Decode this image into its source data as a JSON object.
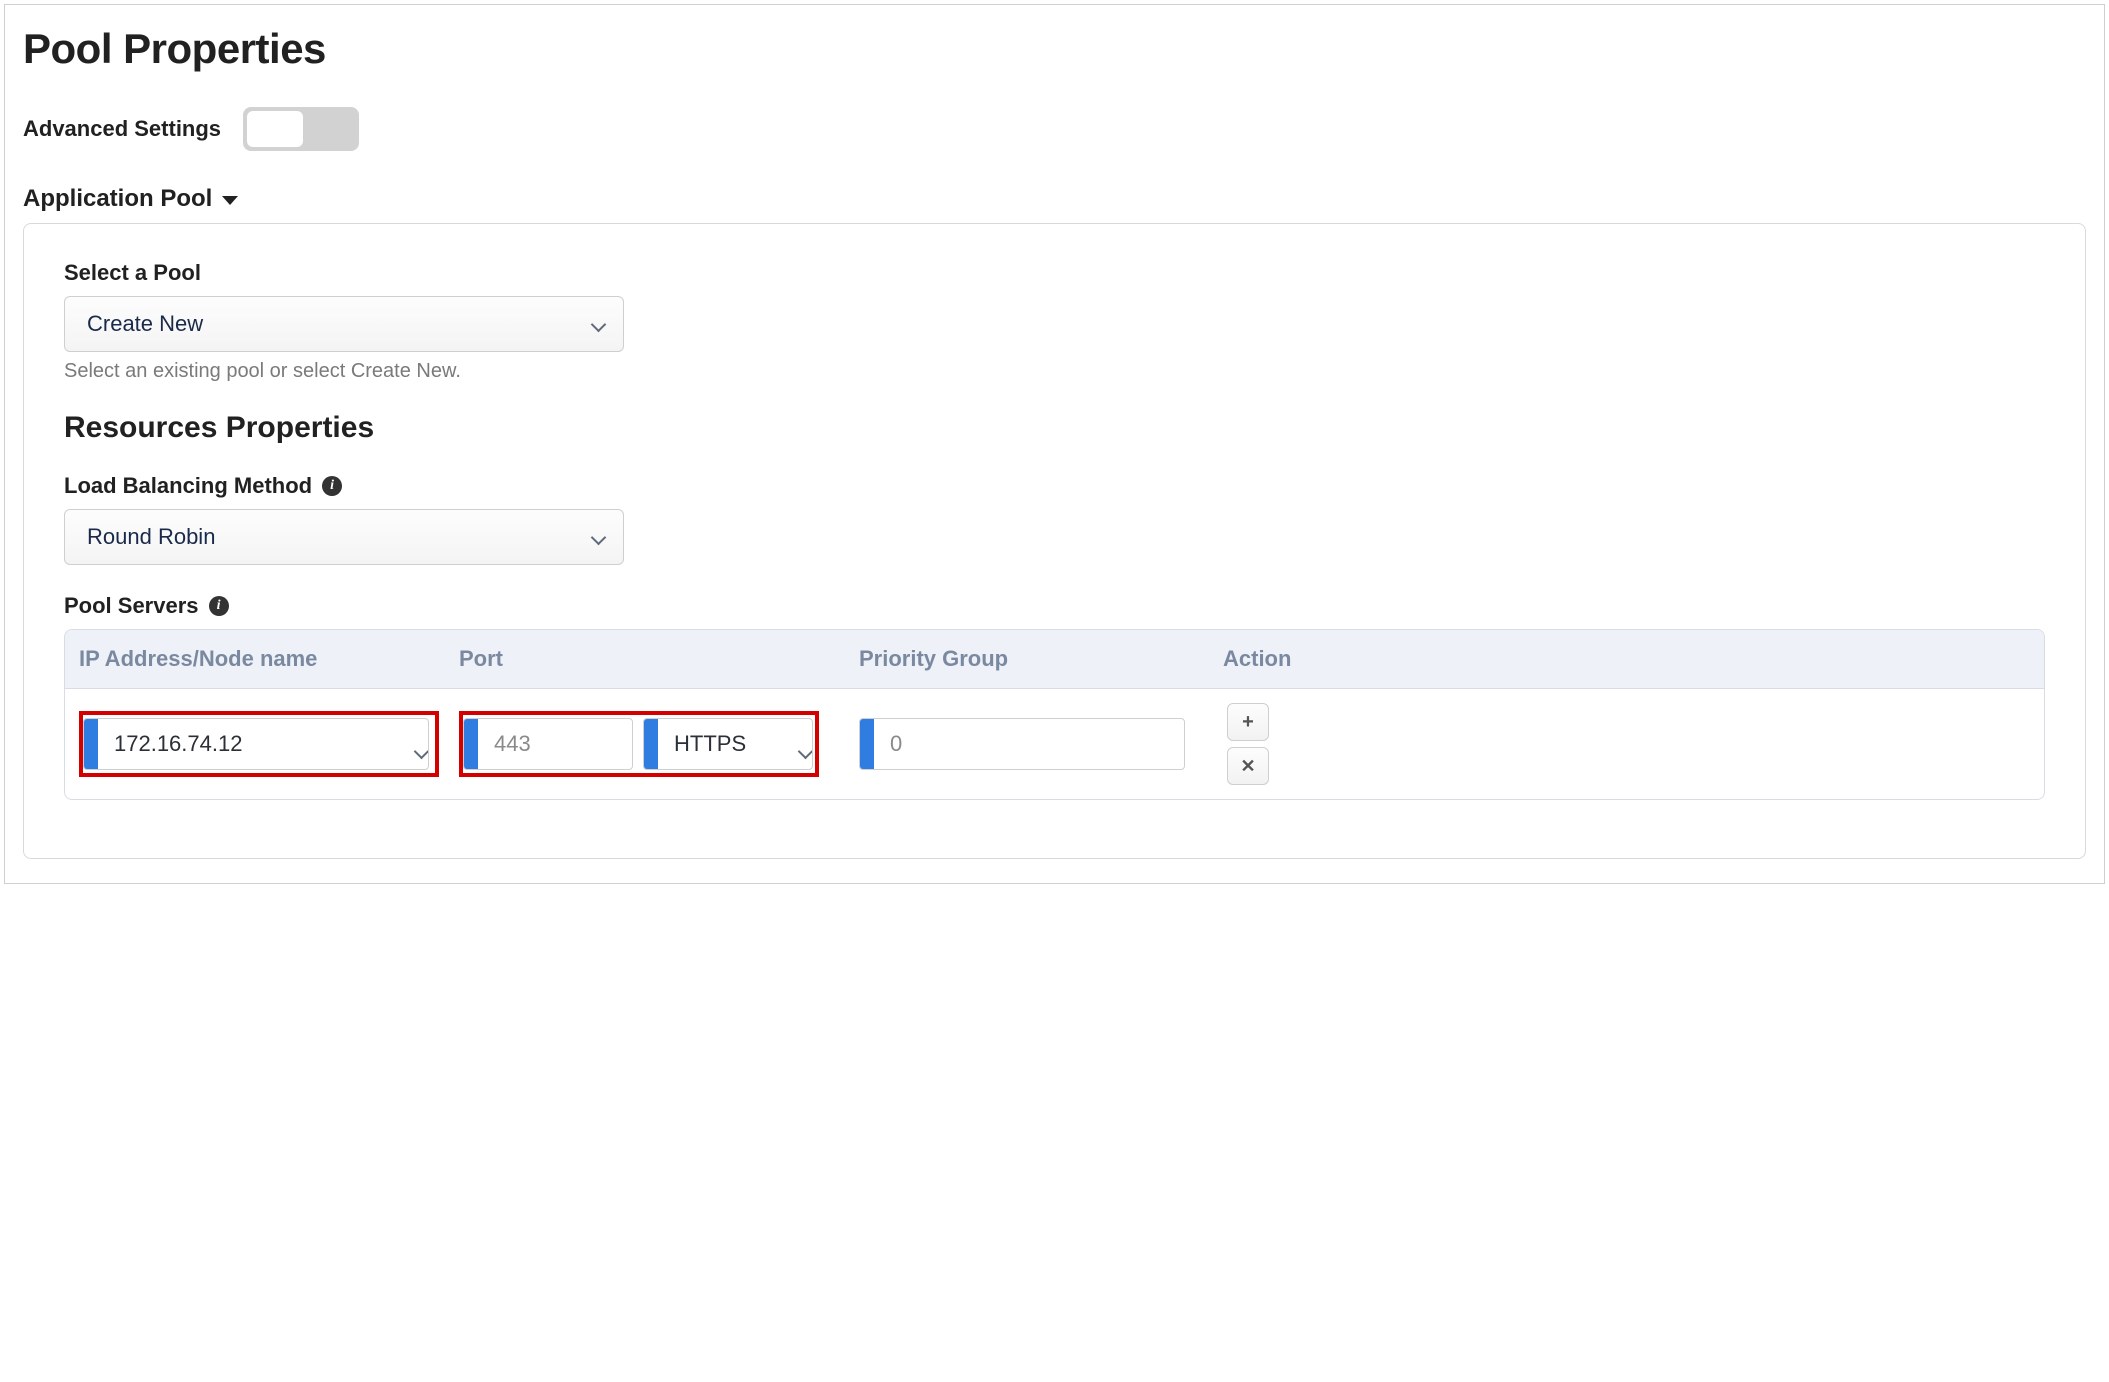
{
  "page": {
    "title": "Pool Properties",
    "advanced_settings_label": "Advanced Settings"
  },
  "section": {
    "app_pool_label": "Application Pool"
  },
  "pool": {
    "select_label": "Select a Pool",
    "select_value": "Create New",
    "select_help": "Select an existing pool or select Create New.",
    "resources_title": "Resources Properties",
    "lb_label": "Load Balancing Method",
    "lb_value": "Round Robin",
    "servers_label": "Pool Servers"
  },
  "table": {
    "headers": {
      "ip": "IP Address/Node name",
      "port": "Port",
      "priority": "Priority Group",
      "action": "Action"
    },
    "rows": [
      {
        "ip": "172.16.74.12",
        "port": "443",
        "protocol": "HTTPS",
        "priority": "0"
      }
    ]
  },
  "icons": {
    "plus": "+",
    "close": "✕",
    "info": "i"
  }
}
